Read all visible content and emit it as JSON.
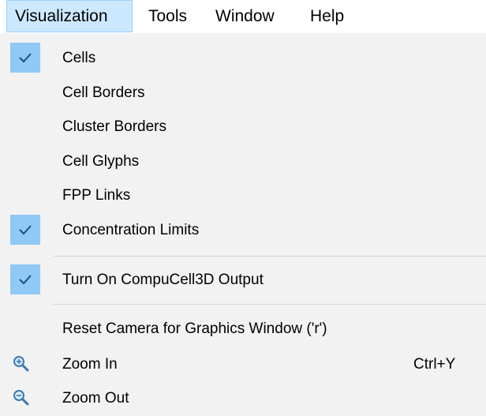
{
  "menubar": {
    "items": [
      {
        "label": "Visualization",
        "active": true
      },
      {
        "label": "Tools",
        "active": false
      },
      {
        "label": "Window",
        "active": false
      },
      {
        "label": "Help",
        "active": false
      }
    ]
  },
  "menu": {
    "items": [
      {
        "label": "Cells",
        "checked": true
      },
      {
        "label": "Cell Borders",
        "checked": false
      },
      {
        "label": "Cluster Borders",
        "checked": false
      },
      {
        "label": "Cell Glyphs",
        "checked": false
      },
      {
        "label": "FPP Links",
        "checked": false
      },
      {
        "label": "Concentration Limits",
        "checked": true
      },
      {
        "label": "Turn On CompuCell3D Output",
        "checked": true
      },
      {
        "label": "Reset Camera for Graphics Window ('r')",
        "checked": false
      },
      {
        "label": "Zoom In",
        "icon": "zoom-in-icon",
        "shortcut": "Ctrl+Y"
      },
      {
        "label": "Zoom Out",
        "icon": "zoom-out-icon"
      }
    ]
  },
  "colors": {
    "menubar_active_bg": "#cce8ff",
    "menubar_active_border": "#99d1ff",
    "menu_bg": "#f2f2f2",
    "check_bg": "#90c8f6",
    "separator": "#d6d6d6"
  }
}
